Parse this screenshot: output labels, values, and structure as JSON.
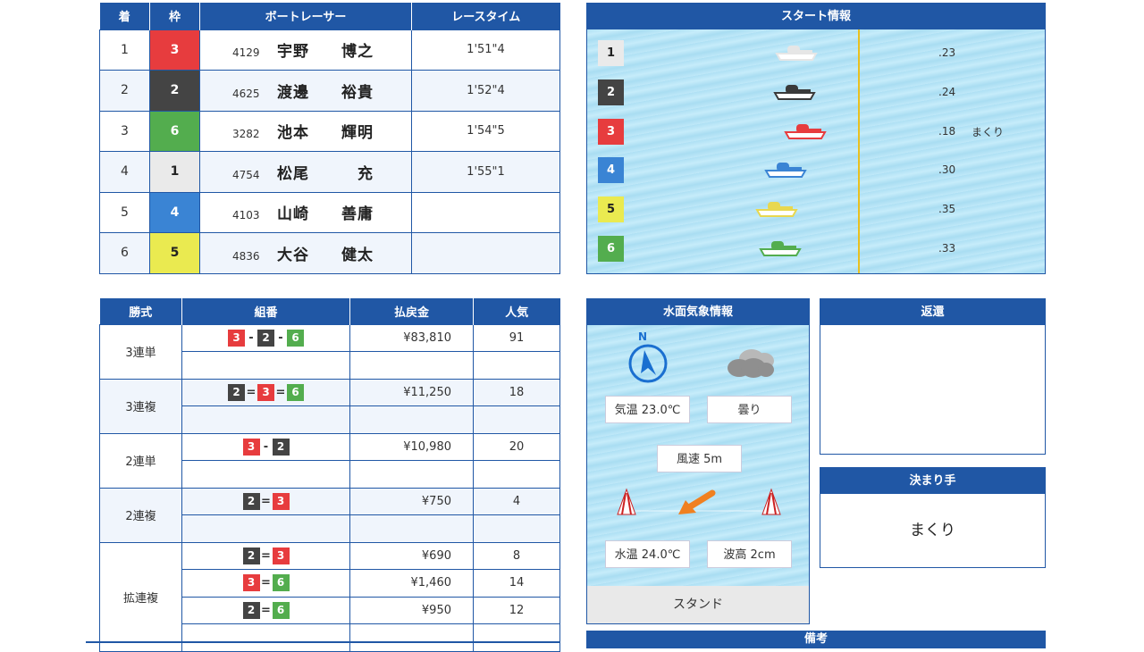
{
  "result": {
    "headers": [
      "着",
      "枠",
      "ボートレーサー",
      "レースタイム"
    ],
    "rows": [
      {
        "rank": "1",
        "waku": "3",
        "reg": "4129",
        "name": "宇野　　博之",
        "time": "1'51\"4"
      },
      {
        "rank": "2",
        "waku": "2",
        "reg": "4625",
        "name": "渡邊　　裕貴",
        "time": "1'52\"4"
      },
      {
        "rank": "3",
        "waku": "6",
        "reg": "3282",
        "name": "池本　　輝明",
        "time": "1'54\"5"
      },
      {
        "rank": "4",
        "waku": "1",
        "reg": "4754",
        "name": "松尾　　　充",
        "time": "1'55\"1"
      },
      {
        "rank": "5",
        "waku": "4",
        "reg": "4103",
        "name": "山崎　　善庸",
        "time": ""
      },
      {
        "rank": "6",
        "waku": "5",
        "reg": "4836",
        "name": "大谷　　健太",
        "time": ""
      }
    ]
  },
  "start_info": {
    "title": "スタート情報",
    "rows": [
      {
        "course": "1",
        "st": ".23",
        "tech": ""
      },
      {
        "course": "2",
        "st": ".24",
        "tech": ""
      },
      {
        "course": "3",
        "st": ".18",
        "tech": "まくり"
      },
      {
        "course": "4",
        "st": ".30",
        "tech": ""
      },
      {
        "course": "5",
        "st": ".35",
        "tech": ""
      },
      {
        "course": "6",
        "st": ".33",
        "tech": ""
      }
    ]
  },
  "payout": {
    "headers": [
      "勝式",
      "組番",
      "払戻金",
      "人気"
    ],
    "groups": [
      {
        "type": "3連単",
        "rows": [
          {
            "combo": [
              "3",
              "-",
              "2",
              "-",
              "6"
            ],
            "amount": "¥83,810",
            "pop": "91"
          }
        ]
      },
      {
        "type": "3連複",
        "rows": [
          {
            "combo": [
              "2",
              "=",
              "3",
              "=",
              "6"
            ],
            "amount": "¥11,250",
            "pop": "18"
          }
        ]
      },
      {
        "type": "2連単",
        "rows": [
          {
            "combo": [
              "3",
              "-",
              "2"
            ],
            "amount": "¥10,980",
            "pop": "20"
          }
        ]
      },
      {
        "type": "2連複",
        "rows": [
          {
            "combo": [
              "2",
              "=",
              "3"
            ],
            "amount": "¥750",
            "pop": "4"
          }
        ]
      },
      {
        "type": "拡連複",
        "rows": [
          {
            "combo": [
              "2",
              "=",
              "3"
            ],
            "amount": "¥690",
            "pop": "8"
          },
          {
            "combo": [
              "3",
              "=",
              "6"
            ],
            "amount": "¥1,460",
            "pop": "14"
          },
          {
            "combo": [
              "2",
              "=",
              "6"
            ],
            "amount": "¥950",
            "pop": "12"
          }
        ]
      }
    ]
  },
  "weather": {
    "title": "水面気象情報",
    "compass_label": "N",
    "temp": "気温 23.0℃",
    "condition": "曇り",
    "wind": "風速 5m",
    "water_temp": "水温 24.0℃",
    "wave": "波高 2cm",
    "stand": "スタンド",
    "compass_icon": "compass-icon",
    "weather_icon": "cloud-icon"
  },
  "refund": {
    "title": "返還",
    "value": ""
  },
  "kimarite": {
    "title": "決まり手",
    "value": "まくり"
  },
  "remarks": {
    "title": "備考"
  },
  "colors": {
    "header": "#2057a5",
    "waku1": "#eaeaea",
    "waku2": "#444444",
    "waku3": "#e73c3e",
    "waku4": "#3a84d4",
    "waku5": "#eaea50",
    "waku6": "#53ad4e"
  }
}
